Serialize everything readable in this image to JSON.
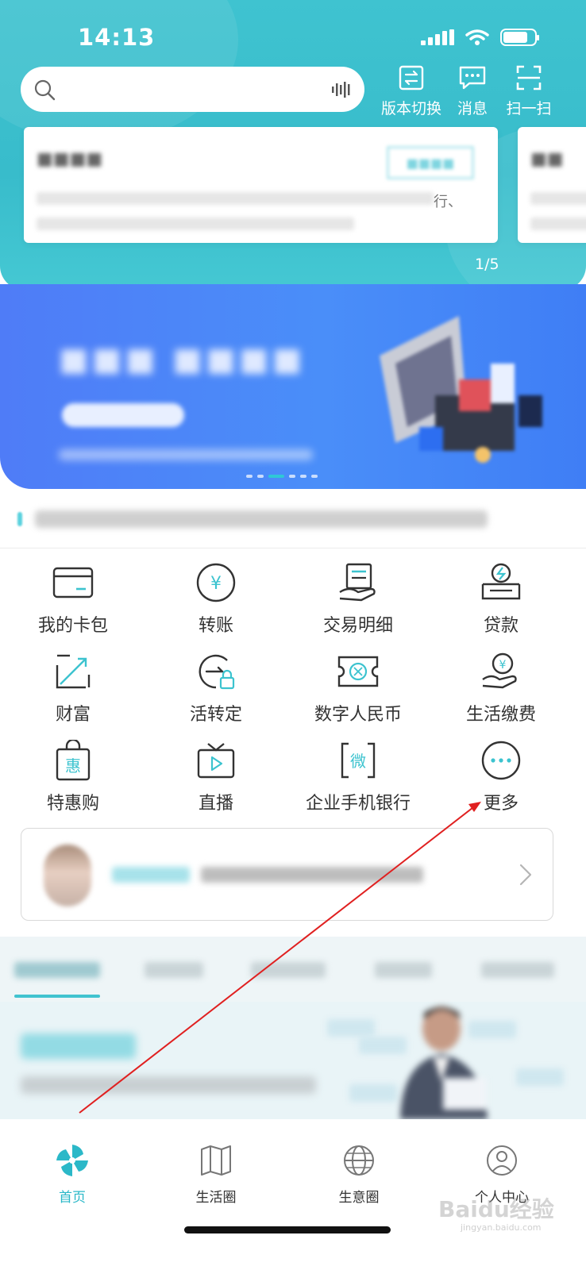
{
  "status_bar": {
    "time": "14:13"
  },
  "search": {
    "placeholder": ""
  },
  "top_actions": [
    {
      "label": "版本切换",
      "icon": "version-switch-icon"
    },
    {
      "label": "消息",
      "icon": "message-icon"
    },
    {
      "label": "扫一扫",
      "icon": "scan-icon"
    }
  ],
  "card_pager": "1/5",
  "card_fragment": "行、",
  "services": [
    {
      "label": "我的卡包",
      "icon": "card-wallet-icon"
    },
    {
      "label": "转账",
      "icon": "transfer-icon"
    },
    {
      "label": "交易明细",
      "icon": "transaction-details-icon"
    },
    {
      "label": "贷款",
      "icon": "loan-icon"
    },
    {
      "label": "财富",
      "icon": "wealth-icon"
    },
    {
      "label": "活转定",
      "icon": "deposit-convert-icon"
    },
    {
      "label": "数字人民币",
      "icon": "digital-rmb-icon"
    },
    {
      "label": "生活缴费",
      "icon": "bill-payment-icon"
    },
    {
      "label": "特惠购",
      "icon": "discount-shop-icon"
    },
    {
      "label": "直播",
      "icon": "live-stream-icon"
    },
    {
      "label": "企业手机银行",
      "icon": "corporate-banking-icon"
    },
    {
      "label": "更多",
      "icon": "more-icon"
    }
  ],
  "tabbar": [
    {
      "label": "首页",
      "icon": "home-icon",
      "active": true
    },
    {
      "label": "生活圈",
      "icon": "life-circle-icon",
      "active": false
    },
    {
      "label": "生意圈",
      "icon": "business-circle-icon",
      "active": false
    },
    {
      "label": "个人中心",
      "icon": "profile-icon",
      "active": false
    }
  ],
  "watermark": {
    "text": "Baidu经验",
    "sub": "jingyan.baidu.com"
  },
  "colors": {
    "accent": "#2bb8c8",
    "header": "#3fc3d0",
    "banner": "#4a8ef9",
    "annotation": "#e02020"
  }
}
